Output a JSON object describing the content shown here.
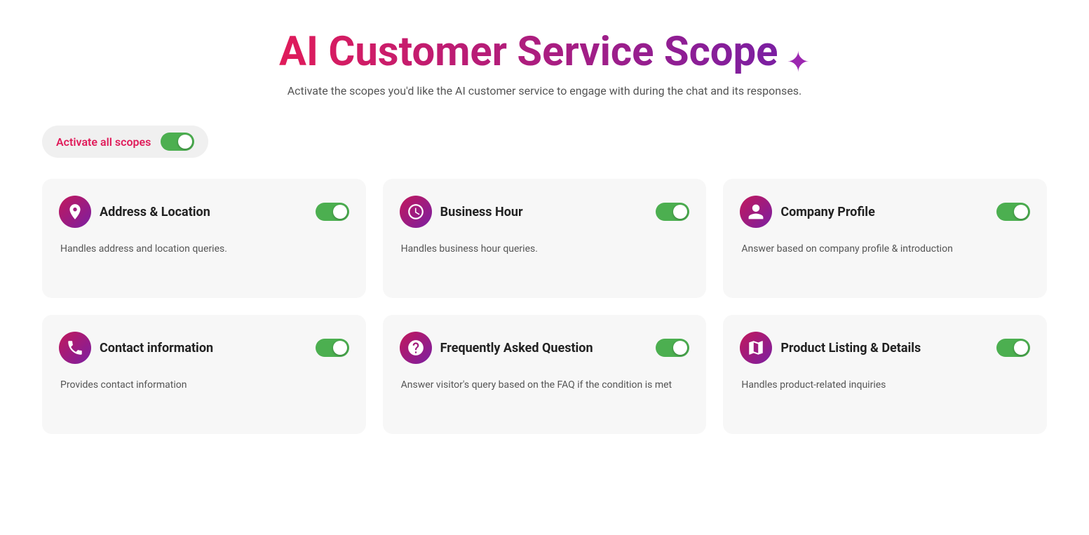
{
  "header": {
    "title": "AI Customer Service Scope",
    "subtitle": "Activate the scopes you'd like the AI customer service to engage with during the chat and its responses."
  },
  "activate_all": {
    "label": "Activate all scopes",
    "enabled": true
  },
  "cards": [
    {
      "id": "address-location",
      "title": "Address & Location",
      "description": "Handles address and location queries.",
      "icon": "location",
      "enabled": true
    },
    {
      "id": "business-hour",
      "title": "Business Hour",
      "description": "Handles business hour queries.",
      "icon": "clock",
      "enabled": true
    },
    {
      "id": "company-profile",
      "title": "Company Profile",
      "description": "Answer based on company profile & introduction",
      "icon": "profile",
      "enabled": true
    },
    {
      "id": "contact-information",
      "title": "Contact information",
      "description": "Provides contact information",
      "icon": "contact",
      "enabled": true
    },
    {
      "id": "frequently-asked-question",
      "title": "Frequently Asked Question",
      "description": "Answer visitor's query based on the FAQ if the condition is met",
      "icon": "faq",
      "enabled": true
    },
    {
      "id": "product-listing",
      "title": "Product Listing & Details",
      "description": "Handles product-related inquiries",
      "icon": "product",
      "enabled": true
    }
  ]
}
